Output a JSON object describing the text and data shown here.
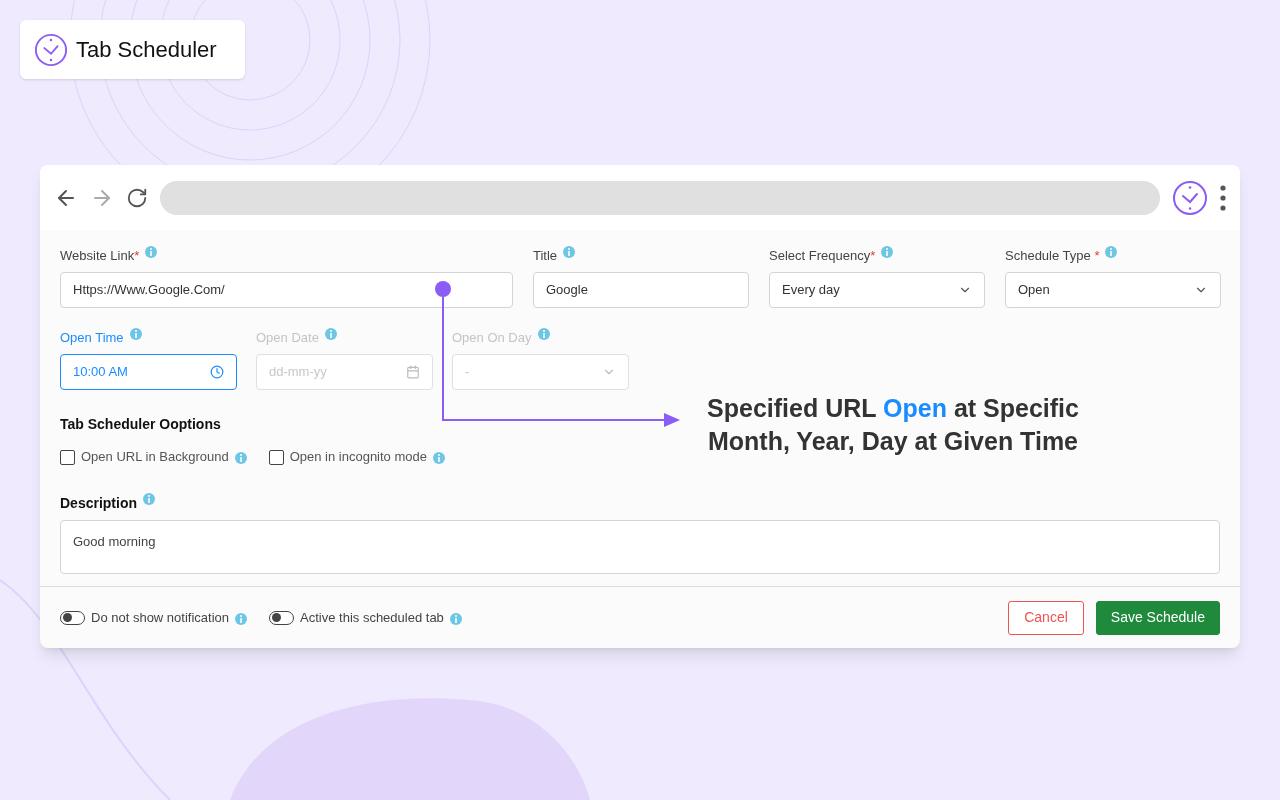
{
  "brand": {
    "name": "Tab Scheduler"
  },
  "fields_row1": [
    {
      "label": "Website Link",
      "required_mark": "*",
      "kind": "text",
      "value": "Https://Www.Google.Com/",
      "focused": false,
      "disabled": false
    },
    {
      "label": "Title",
      "kind": "text",
      "value": "Google",
      "focused": false,
      "disabled": false
    },
    {
      "label": "Select Frequency",
      "required_mark": "*",
      "kind": "select",
      "value": "Every day",
      "focused": false,
      "disabled": false
    },
    {
      "label": "Schedule Type ",
      "required_mark": "*",
      "kind": "select",
      "value": "Open",
      "focused": false,
      "disabled": false
    }
  ],
  "fields_row2": [
    {
      "label": "Open Time",
      "kind": "time",
      "value": "10:00 AM",
      "focused": true,
      "disabled": false
    },
    {
      "label": "Open Date",
      "kind": "date",
      "placeholder": "dd-mm-yy",
      "focused": false,
      "disabled": true
    },
    {
      "label": "Open On Day",
      "kind": "select",
      "value": "-",
      "focused": false,
      "disabled": true
    }
  ],
  "options": {
    "title": "Tab Scheduler Ooptions",
    "items": [
      {
        "label": "Open URL in Background",
        "checked": false
      },
      {
        "label": "Open in incognito mode",
        "checked": false
      }
    ]
  },
  "description": {
    "label": "Description",
    "value": "Good morning"
  },
  "toggles": [
    {
      "label": "Do not show notification",
      "on": false
    },
    {
      "label": "Active this scheduled tab",
      "on": false
    }
  ],
  "buttons": [
    {
      "label": "Cancel",
      "kind": "secondary"
    },
    {
      "label": "Save Schedule",
      "kind": "primary"
    }
  ],
  "caption": [
    {
      "text": "Specified URL ",
      "highlight": false
    },
    {
      "text": "Open",
      "highlight": true
    },
    {
      "text": " at Specific Month, Year, Day at Given Time",
      "highlight": false
    }
  ]
}
